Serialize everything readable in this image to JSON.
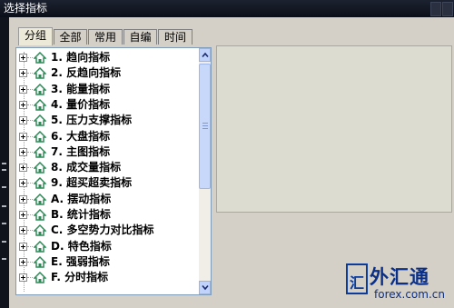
{
  "window": {
    "title": "选择指标"
  },
  "tabs": [
    {
      "label": "分组",
      "active": true
    },
    {
      "label": "全部",
      "active": false
    },
    {
      "label": "常用",
      "active": false
    },
    {
      "label": "自编",
      "active": false
    },
    {
      "label": "时间",
      "active": false
    }
  ],
  "tree": {
    "items": [
      "1. 趋向指标",
      "2. 反趋向指标",
      "3. 能量指标",
      "4. 量价指标",
      "5. 压力支撑指标",
      "6. 大盘指标",
      "7. 主图指标",
      "8. 成交量指标",
      "9. 超买超卖指标",
      "A. 摆动指标",
      "B. 统计指标",
      "C. 多空势力对比指标",
      "D. 特色指标",
      "E. 强弱指标",
      "F. 分时指标"
    ]
  },
  "watermark": {
    "logo_char": "汇",
    "name": "外汇通",
    "url": "forex.com.cn"
  },
  "colors": {
    "titlebar": "#0a0e18",
    "dialog": "#d4d0c8",
    "home_icon": "#2e8b57",
    "watermark": "#0b3c9c"
  },
  "icons": {
    "expander": "plus-box-icon",
    "folder": "home-icon",
    "scroll_up": "chevron-up-icon",
    "scroll_down": "chevron-down-icon"
  }
}
